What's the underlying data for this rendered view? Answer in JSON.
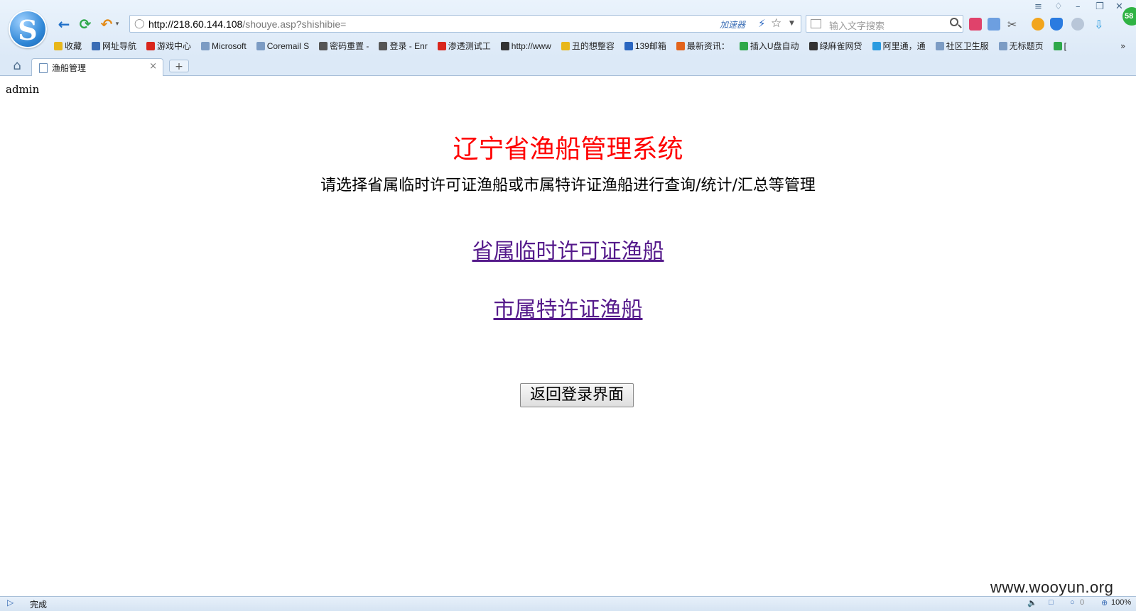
{
  "browser": {
    "logo_letter": "S",
    "address_host": "http://218.60.144.108",
    "address_path": "/shouye.asp?shishibie=",
    "accelerator_label": "加速器",
    "search_placeholder": "输入文字搜索",
    "badge_count": "58",
    "bookmarks": [
      {
        "label": "收藏",
        "icon": "star-icon",
        "color": "#e8b71a"
      },
      {
        "label": "网址导航",
        "icon": "globe-icon",
        "color": "#3a6db5"
      },
      {
        "label": "游戏中心",
        "icon": "game-icon",
        "color": "#d9261c"
      },
      {
        "label": "Microsoft",
        "icon": "folder-icon",
        "color": "#7c9cc4"
      },
      {
        "label": "Coremail S",
        "icon": "page-icon",
        "color": "#7c9cc4"
      },
      {
        "label": "密码重置 -",
        "icon": "image-icon",
        "color": "#555555"
      },
      {
        "label": "登录 - Enr",
        "icon": "image-icon",
        "color": "#555555"
      },
      {
        "label": "渗透测试工",
        "icon": "c-icon",
        "color": "#d9261c"
      },
      {
        "label": "http://www",
        "icon": "image-icon",
        "color": "#333333"
      },
      {
        "label": "丑的想整容",
        "icon": "star-icon",
        "color": "#e8b71a"
      },
      {
        "label": "139邮箱",
        "icon": "mail-139-icon",
        "color": "#2a66c0"
      },
      {
        "label": "最新资讯：",
        "icon": "windows-icon",
        "color": "#e3641c"
      },
      {
        "label": "插入U盘自动",
        "icon": "f-icon",
        "color": "#2ea84a"
      },
      {
        "label": "绿麻雀网贷",
        "icon": "image-icon",
        "color": "#333333"
      },
      {
        "label": "阿里通，通",
        "icon": "e-icon",
        "color": "#2a9be0"
      },
      {
        "label": "社区卫生服",
        "icon": "page-icon",
        "color": "#7c9cc4"
      },
      {
        "label": "无标题页",
        "icon": "page-icon",
        "color": "#7c9cc4"
      },
      {
        "label": "[",
        "icon": "check-icon",
        "color": "#2ea84a"
      }
    ],
    "tab_label": "渔船管理",
    "tab_close": "×",
    "new_tab": "+",
    "status_text": "完成",
    "volume_count": "0",
    "zoom_level": "100%"
  },
  "page": {
    "user": "admin",
    "title": "辽宁省渔船管理系统",
    "subtitle": "请选择省属临时许可证渔船或市属特许证渔船进行查询/统计/汇总等管理",
    "link_provincial": "省属临时许可证渔船",
    "link_city": "市属特许证渔船",
    "back_button": "返回登录界面",
    "title_color": "#ff0000",
    "link_color": "#551a8b"
  },
  "watermark": "www.wooyun.org"
}
